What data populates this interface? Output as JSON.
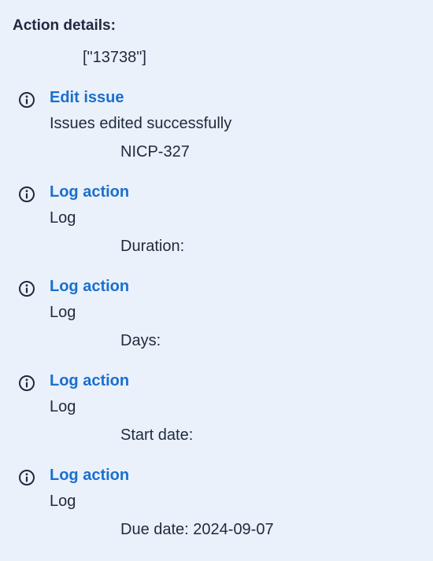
{
  "header": {
    "title": "Action details:",
    "value": "[\"13738\"]"
  },
  "entries": [
    {
      "icon": "info-icon",
      "title": "Edit issue",
      "description": "Issues edited successfully",
      "detail": "NICP-327"
    },
    {
      "icon": "info-icon",
      "title": "Log action",
      "description": "Log",
      "detail": "Duration:"
    },
    {
      "icon": "info-icon",
      "title": "Log action",
      "description": "Log",
      "detail": "Days:"
    },
    {
      "icon": "info-icon",
      "title": "Log action",
      "description": "Log",
      "detail": "Start date:"
    },
    {
      "icon": "info-icon",
      "title": "Log action",
      "description": "Log",
      "detail": "Due date: 2024-09-07"
    }
  ],
  "colors": {
    "background": "#eaf1fb",
    "link": "#1a6fce",
    "text": "#1f2a3d"
  }
}
